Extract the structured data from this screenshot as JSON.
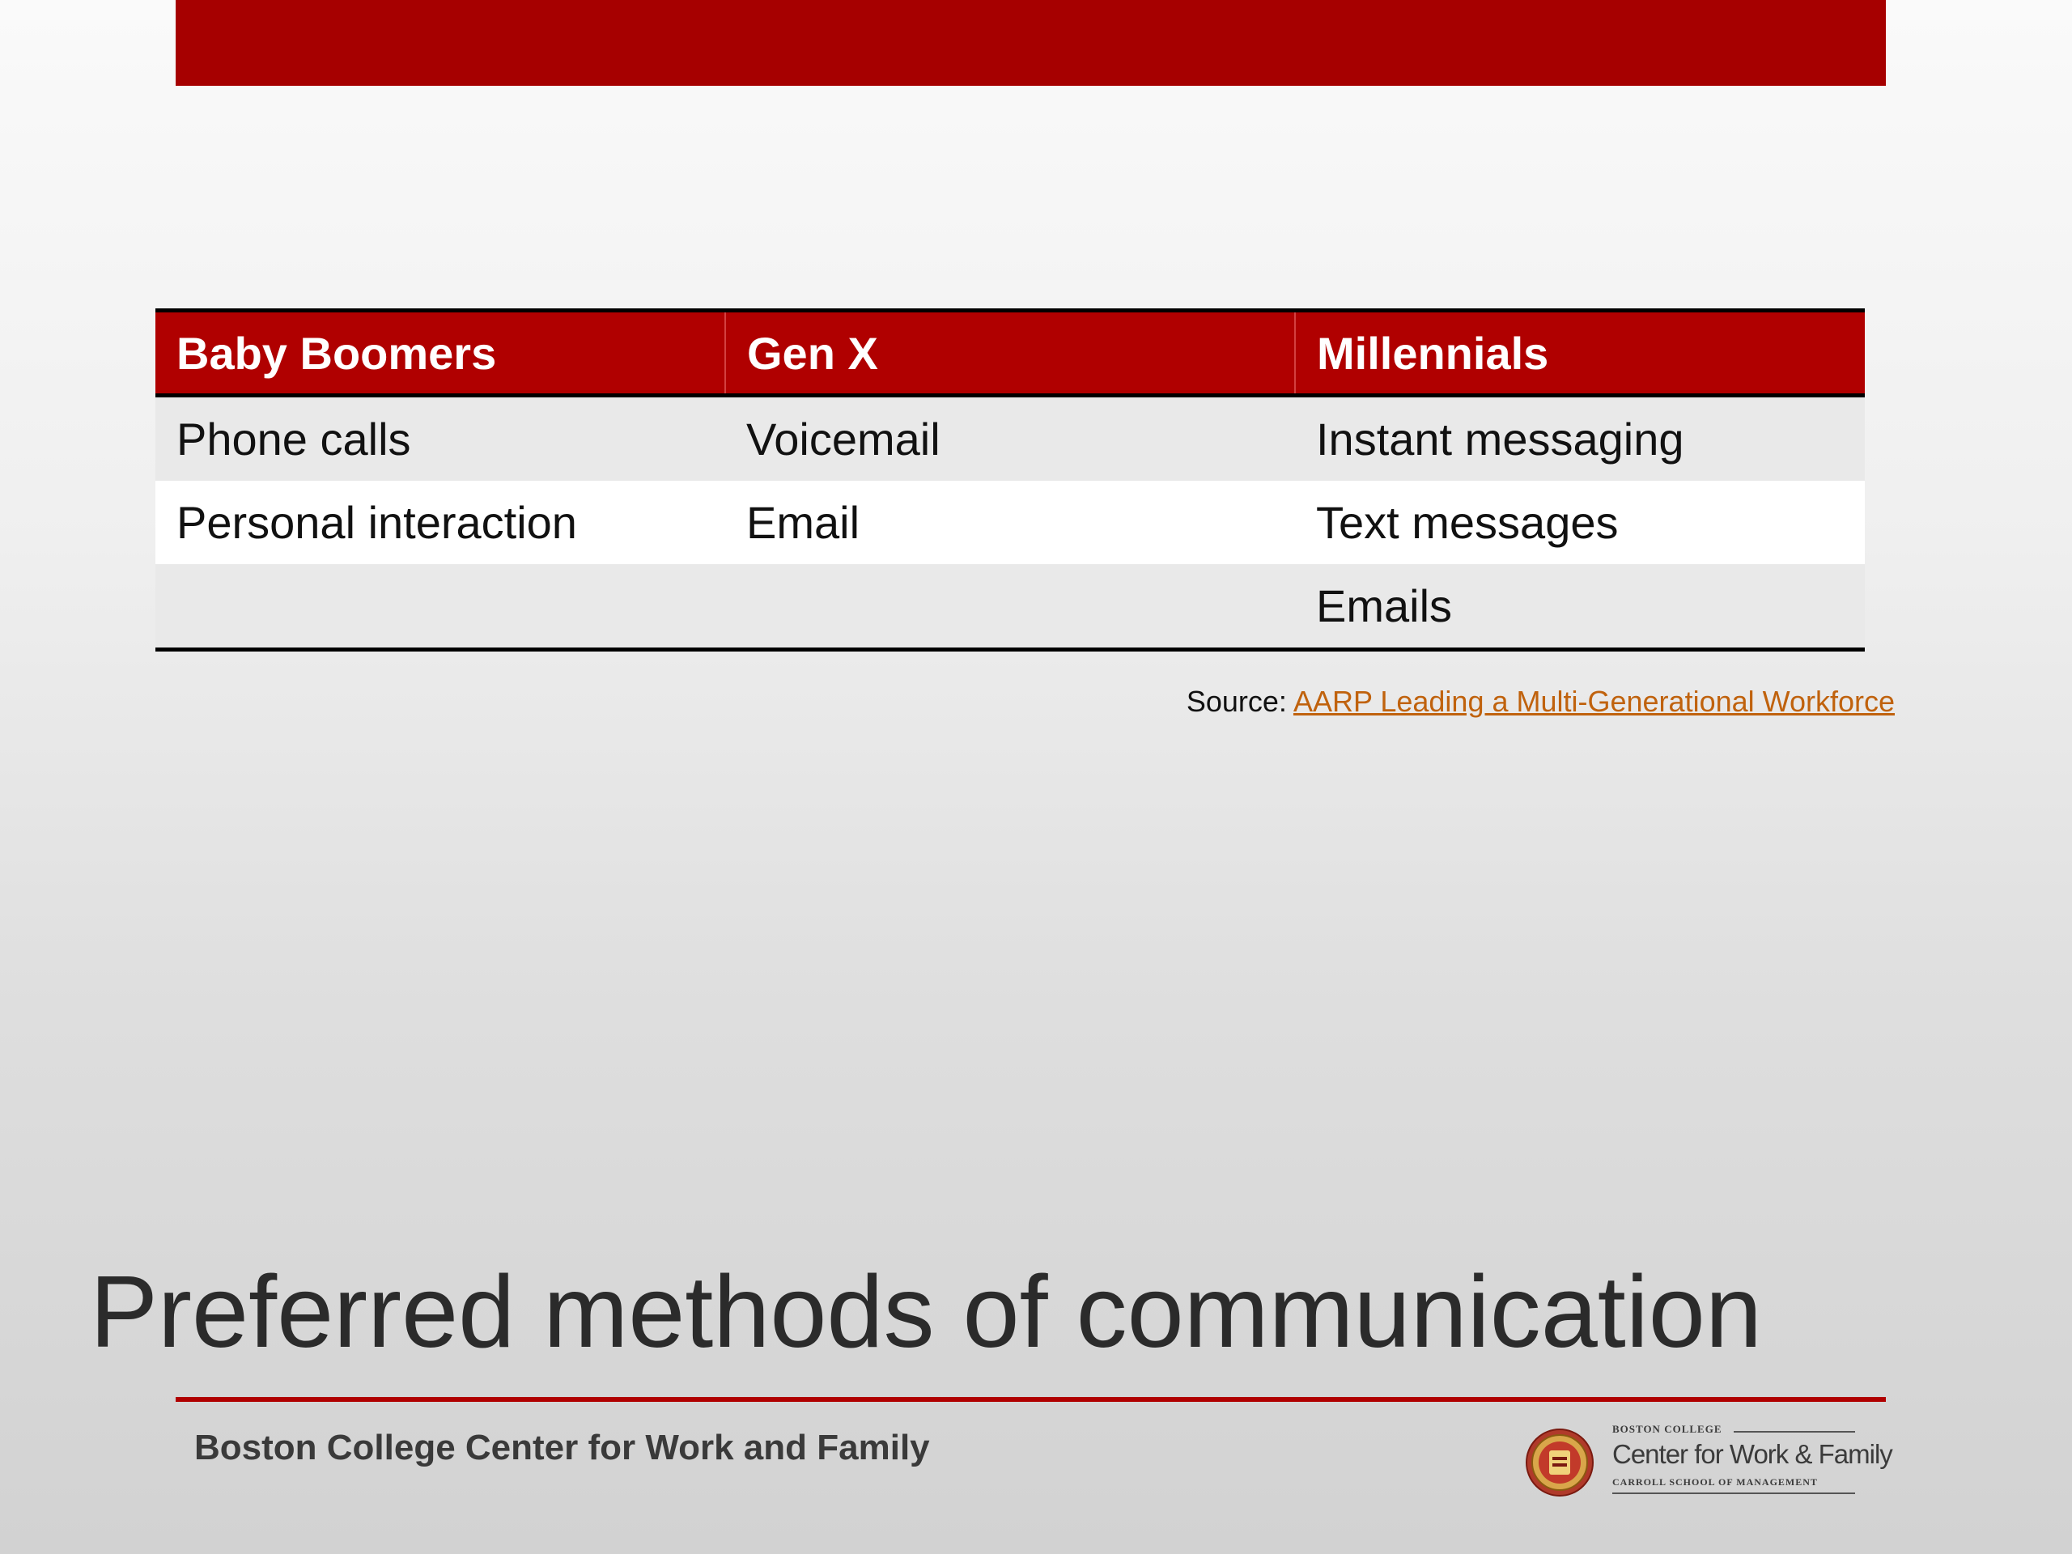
{
  "table": {
    "headers": [
      "Baby Boomers",
      "Gen X",
      "Millennials"
    ],
    "rows": [
      [
        "Phone calls",
        "Voicemail",
        "Instant messaging"
      ],
      [
        "Personal interaction",
        "Email",
        "Text messages"
      ],
      [
        "",
        "",
        "Emails"
      ]
    ]
  },
  "source": {
    "label": "Source: ",
    "link_text": "AARP Leading a Multi-Generational Workforce"
  },
  "title": "Preferred methods of communication",
  "footer": {
    "org_name": "Boston College Center for Work and Family",
    "logo": {
      "top_text": "Boston College",
      "main_text": "Center for Work & Family",
      "sub_text": "CARROLL SCHOOL OF MANAGEMENT"
    }
  },
  "colors": {
    "brand_red": "#a60000",
    "link_orange": "#c0620d"
  }
}
